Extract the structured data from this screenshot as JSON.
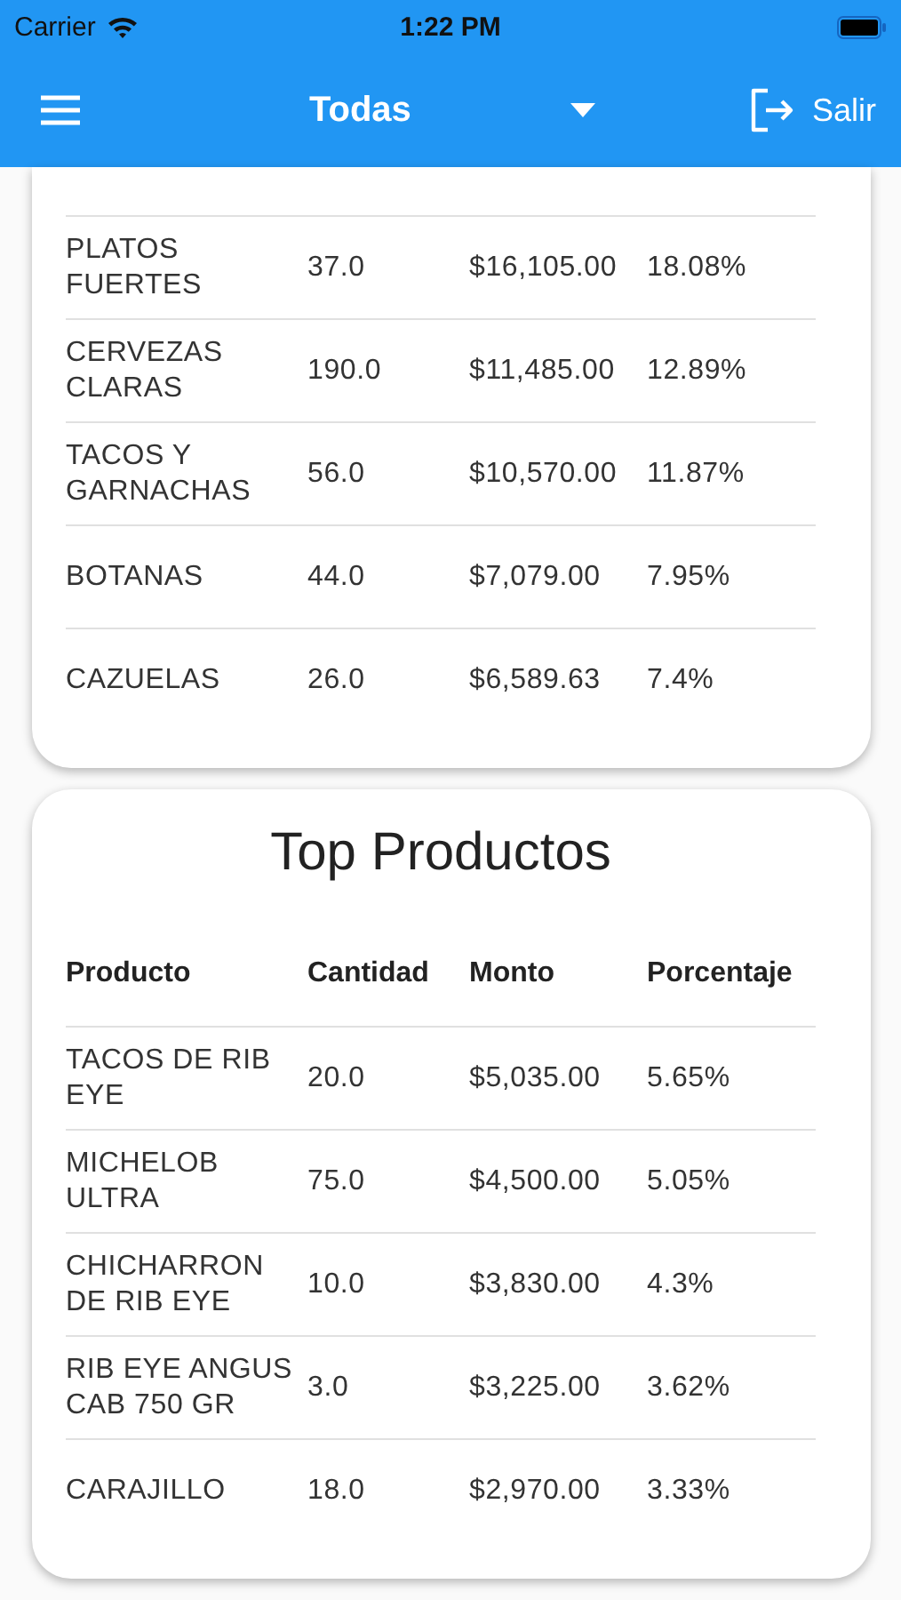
{
  "status_bar": {
    "carrier": "Carrier",
    "time": "1:22 PM"
  },
  "app_bar": {
    "title": "Todas",
    "action": "Salir"
  },
  "categories_card": {
    "rows": [
      [
        "PLATOS FUERTES",
        "37.0",
        "$16,105.00",
        "18.08%"
      ],
      [
        "CERVEZAS CLARAS",
        "190.0",
        "$11,485.00",
        "12.89%"
      ],
      [
        "TACOS Y GARNACHAS",
        "56.0",
        "$10,570.00",
        "11.87%"
      ],
      [
        "BOTANAS",
        "44.0",
        "$7,079.00",
        "7.95%"
      ],
      [
        "CAZUELAS",
        "26.0",
        "$6,589.63",
        "7.4%"
      ]
    ]
  },
  "products_card": {
    "title": "Top Productos",
    "columns": [
      "Producto",
      "Cantidad",
      "Monto",
      "Porcentaje"
    ],
    "rows": [
      [
        "TACOS DE RIB EYE",
        "20.0",
        "$5,035.00",
        "5.65%"
      ],
      [
        "MICHELOB ULTRA",
        "75.0",
        "$4,500.00",
        "5.05%"
      ],
      [
        "CHICHARRON DE RIB EYE",
        "10.0",
        "$3,830.00",
        "4.3%"
      ],
      [
        "RIB EYE ANGUS CAB 750 GR",
        "3.0",
        "$3,225.00",
        "3.62%"
      ],
      [
        "CARAJILLO",
        "18.0",
        "$2,970.00",
        "3.33%"
      ]
    ]
  }
}
